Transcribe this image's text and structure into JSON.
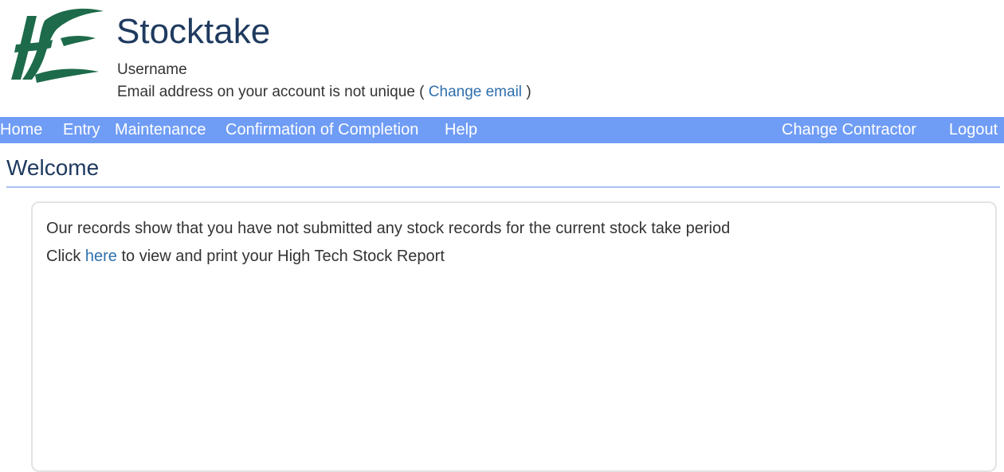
{
  "header": {
    "app_title": "Stocktake",
    "username": "Username",
    "email_notice_prefix": "Email address on your account is not unique (",
    "change_email_link": "Change email",
    "email_notice_suffix": ")",
    "logo_name": "hse-logo",
    "logo_text": "HSE",
    "logo_color": "#1d6b4a"
  },
  "nav": {
    "background": "#6f9cf5",
    "items": [
      {
        "label": "Home"
      },
      {
        "label": "Entry"
      },
      {
        "label": "Maintenance"
      },
      {
        "label": "Confirmation of Completion"
      },
      {
        "label": "Help"
      }
    ],
    "right_items": [
      {
        "label": "Change Contractor"
      },
      {
        "label": "Logout"
      }
    ]
  },
  "main": {
    "page_title": "Welcome",
    "message_line1": "Our records show that you have not submitted any stock records for the current stock take period",
    "message_line2_prefix": "Click ",
    "here_link": "here",
    "message_line2_suffix": " to view and print your High Tech Stock Report"
  }
}
